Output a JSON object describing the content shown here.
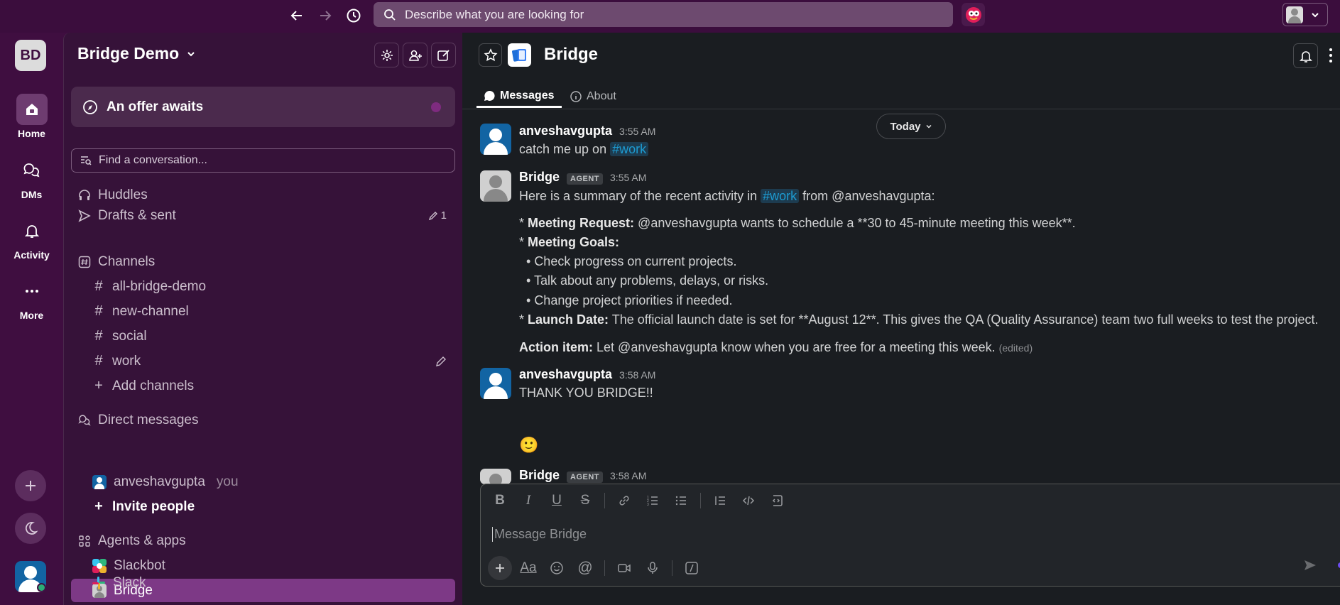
{
  "topbar": {
    "search_placeholder": "Describe what you are looking for"
  },
  "rail": {
    "workspace_initials": "BD",
    "items": [
      {
        "label": "Home",
        "icon": "home-icon"
      },
      {
        "label": "DMs",
        "icon": "dms-icon"
      },
      {
        "label": "Activity",
        "icon": "bell-icon"
      },
      {
        "label": "More",
        "icon": "more-icon"
      }
    ]
  },
  "sidebar": {
    "workspace_name": "Bridge Demo",
    "offer": "An offer awaits",
    "find_placeholder": "Find a conversation...",
    "huddles": "Huddles",
    "drafts": "Drafts & sent",
    "drafts_count": "1",
    "channels_header": "Channels",
    "channels": [
      "all-bridge-demo",
      "new-channel",
      "social",
      "work"
    ],
    "add_channels": "Add channels",
    "dm_header": "Direct messages",
    "dm_user": "anveshavgupta",
    "dm_you": "you",
    "invite": "Invite people",
    "apps_header": "Agents & apps",
    "apps": [
      "Slackbot",
      "Bridge",
      "Slack"
    ]
  },
  "channel": {
    "title": "Bridge",
    "tabs": {
      "messages": "Messages",
      "about": "About"
    },
    "today": "Today"
  },
  "messages": {
    "m1": {
      "name": "anveshavgupta",
      "time": "3:55 AM",
      "text": "catch me up on",
      "mention": "#work"
    },
    "m2": {
      "name": "Bridge",
      "badge": "AGENT",
      "time": "3:55 AM",
      "intro_a": "Here is a summary of the recent activity in",
      "intro_mention": "#work",
      "intro_b": "from @anveshavgupta:",
      "l1_label": "Meeting Request:",
      "l1_text": "@anveshavgupta wants to schedule a **30 to 45-minute meeting this week**.",
      "l2_label": "Meeting Goals:",
      "bullets": [
        "Check progress on current projects.",
        "Talk about any problems, delays, or risks.",
        "Change project priorities if needed."
      ],
      "l3_label": "Launch Date:",
      "l3_text": "The official launch date is set for **August 12**. This gives the QA (Quality Assurance) team two full weeks to test the project.",
      "action_label": "Action item:",
      "action_text": "Let @anveshavgupta know when you are free for a meeting this week.",
      "edited": "(edited)"
    },
    "m3": {
      "name": "anveshavgupta",
      "time": "3:58 AM",
      "text": "THANK YOU BRIDGE!!",
      "emoji": "🙂"
    },
    "m4": {
      "name": "Bridge",
      "badge": "AGENT",
      "time": "3:58 AM"
    }
  },
  "composer": {
    "placeholder": "Message Bridge",
    "format_label": "Aa"
  }
}
